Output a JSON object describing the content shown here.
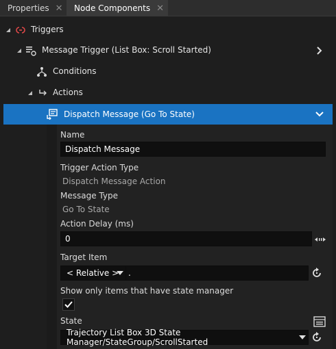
{
  "tabs": [
    {
      "label": "Properties",
      "icon": "list-icon",
      "active": false
    },
    {
      "label": "Node Components",
      "icon": "node-components-icon",
      "active": true
    }
  ],
  "tree": {
    "triggers": {
      "label": "Triggers",
      "icon": "trigger-icon"
    },
    "message_trigger": {
      "label": "Message Trigger (List Box: Scroll Started)",
      "icon": "message-trigger-icon"
    },
    "conditions": {
      "label": "Conditions",
      "icon": "conditions-icon"
    },
    "actions": {
      "label": "Actions",
      "icon": "actions-icon"
    },
    "dispatch": {
      "label": "Dispatch Message (Go To State)",
      "icon": "dispatch-message-icon"
    }
  },
  "fields": {
    "name": {
      "label": "Name",
      "value": "Dispatch Message"
    },
    "trigger_action_type": {
      "label": "Trigger Action Type",
      "value": "Dispatch Message Action"
    },
    "message_type": {
      "label": "Message Type",
      "value": "Go To State"
    },
    "action_delay": {
      "label": "Action Delay (ms)",
      "value": "0"
    },
    "target_item": {
      "label": "Target Item",
      "combo": "< Relative >",
      "value": "."
    },
    "show_only": {
      "label": "Show only items that have state manager",
      "checked": true
    },
    "state": {
      "label": "State",
      "value": "Trajectory List Box 3D State Manager/StateGroup/ScrollStarted"
    }
  },
  "colors": {
    "selection": "#1a73c2",
    "background": "#1e1e1e",
    "input_background": "#0f0f0f",
    "trigger_red": "#e04848"
  }
}
